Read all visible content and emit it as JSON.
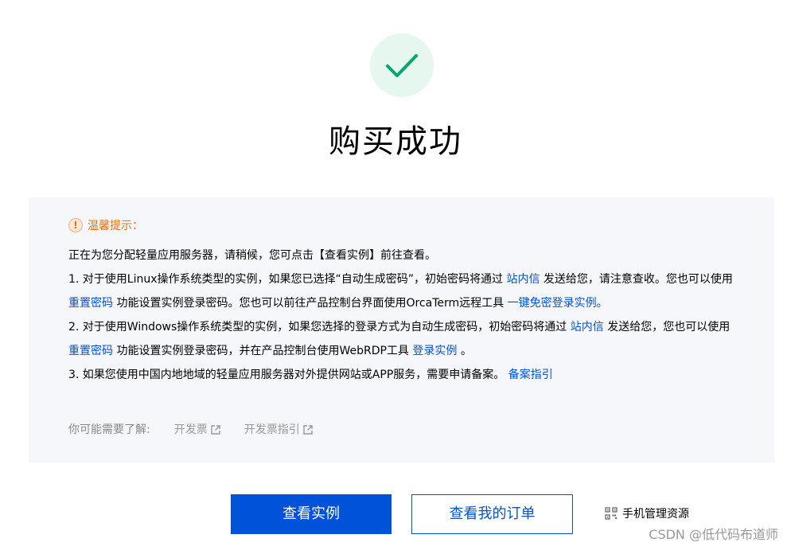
{
  "status": {
    "icon": "check-icon",
    "title": "购买成功"
  },
  "tips": {
    "icon": "warning-icon",
    "label": "温馨提示：",
    "intro": "正在为您分配轻量应用服务器，请稍候，您可点击【查看实例】前往查看。",
    "item1": {
      "t1": "1. 对于使用Linux操作系统类型的实例，如果您已选择“自动生成密码”，初始密码将通过 ",
      "link1": "站内信",
      "t2": " 发送给您，请注意查收。您也可以使用 ",
      "link2": "重置密码",
      "t3": " 功能设置实例登录密码。您也可以前往产品控制台界面使用OrcaTerm远程工具 ",
      "link3": "一键免密登录实例。"
    },
    "item2": {
      "t1": "2. 对于使用Windows操作系统类型的实例，如果您选择的登录方式为自动生成密码，初始密码将通过 ",
      "link1": "站内信",
      "t2": " 发送给您，您也可以使用 ",
      "link2": "重置密码",
      "t3": " 功能设置实例登录密码，并在产品控制台使用WebRDP工具 ",
      "link3": "登录实例",
      "t4": " 。"
    },
    "item3": {
      "t1": "3. 如果您使用中国内地地域的轻量应用服务器对外提供网站或APP服务，需要申请备案。 ",
      "link1": "备案指引"
    }
  },
  "more": {
    "label": "你可能需要了解:",
    "links": [
      "开发票",
      "开发票指引"
    ],
    "link_icon": "external-link-icon"
  },
  "actions": {
    "view_instance": "查看实例",
    "view_orders": "查看我的订单",
    "mobile_manage": "手机管理资源",
    "mobile_icon": "qr-code-icon"
  },
  "watermark": "CSDN @低代码布道师",
  "colors": {
    "primary": "#0052d9",
    "success": "#00a870",
    "success_bg": "#e6f7f0",
    "warning": "#e37318",
    "panel_bg": "#f5f7fa"
  }
}
